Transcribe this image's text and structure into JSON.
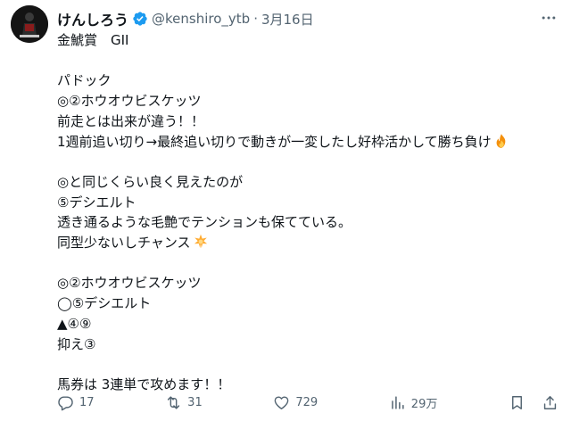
{
  "author": {
    "display_name": "けんしろう",
    "handle": "@kenshiro_ytb",
    "separator": "·",
    "date": "3月16日",
    "verified": true,
    "avatar_icon": "avatar-image"
  },
  "tweet": {
    "lines": [
      "金鯱賞　GII",
      "",
      "パドック",
      "◎②ホウオウビスケッツ",
      "前走とは出来が違う！！",
      "1週前追い切り→最終追い切りで動きが一変したし好枠活かして勝ち負け",
      "",
      "◎と同じくらい良く見えたのが",
      "⑤デシエルト",
      "透き通るような毛艶でテンションも保てている。",
      "同型少ないしチャンス",
      "",
      "◎②ホウオウビスケッツ",
      "◯⑤デシエルト",
      "▲④⑨",
      "抑え③",
      "",
      "馬券は 3連単で攻めます！！"
    ],
    "emojis": {
      "fire": "fire-emoji",
      "sparkle": "sparkle-emoji"
    }
  },
  "actions": {
    "replies": "17",
    "retweets": "31",
    "likes": "729",
    "views": "29万"
  },
  "colors": {
    "text": "#0f1419",
    "secondary": "#536471",
    "verified_blue": "#1d9bf0"
  }
}
